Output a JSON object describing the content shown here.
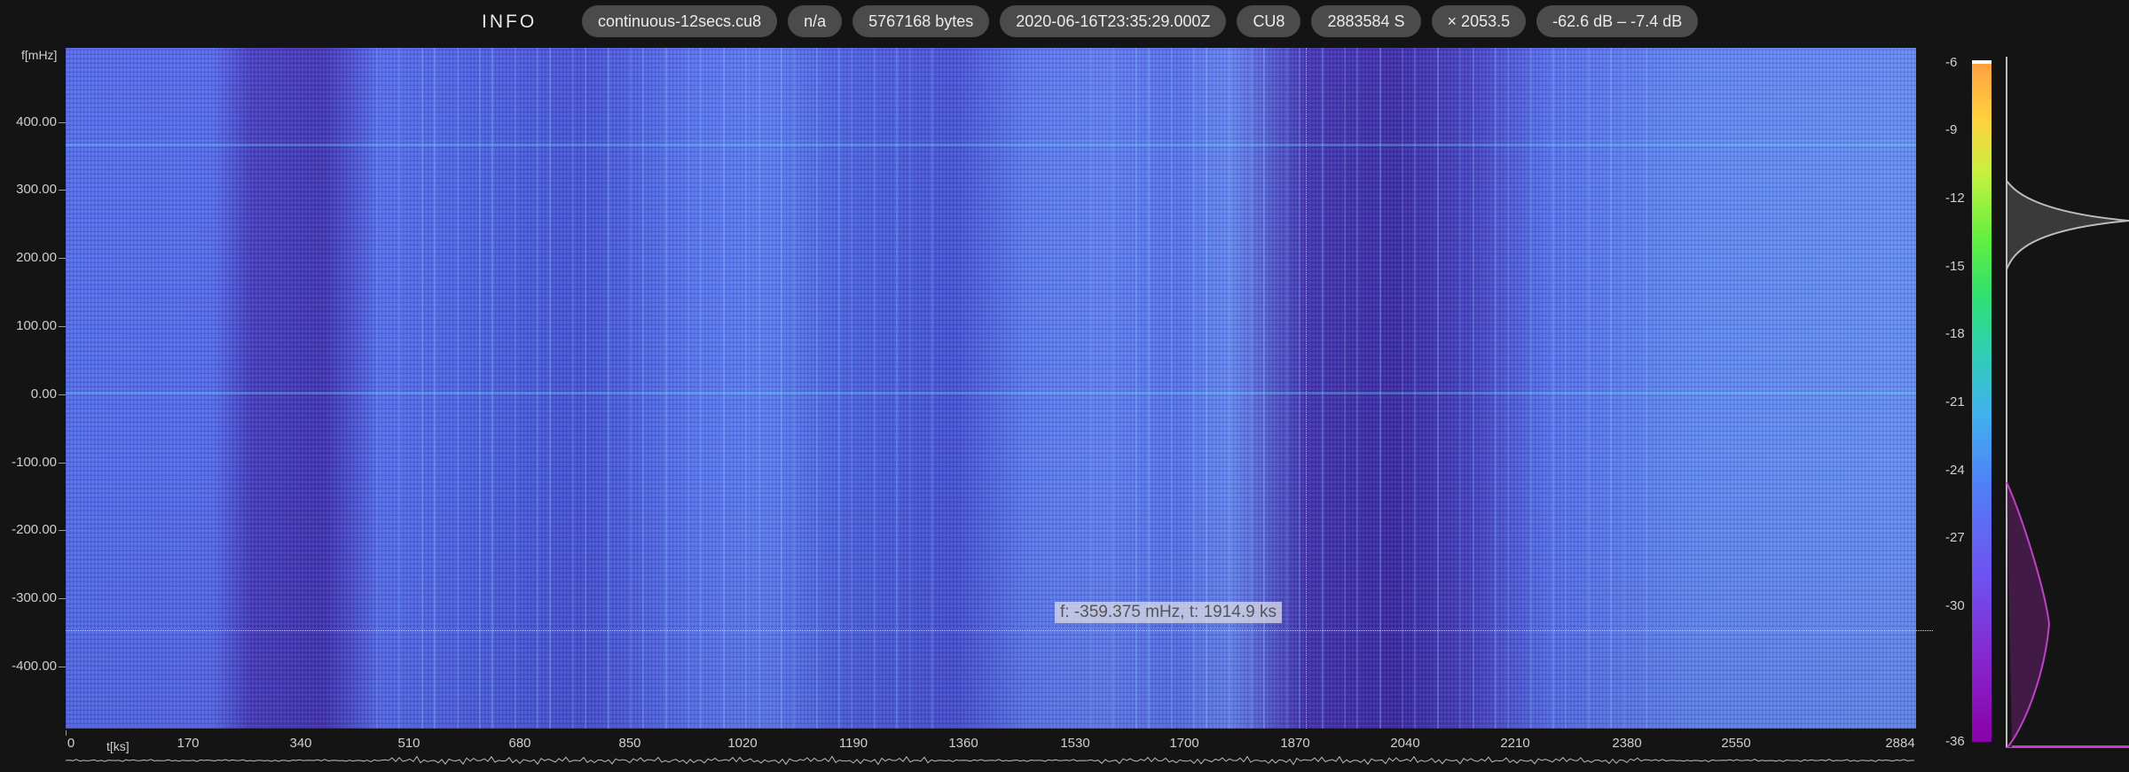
{
  "header": {
    "title": "INFO",
    "pills": [
      "continuous-12secs.cu8",
      "n/a",
      "5767168 bytes",
      "2020-06-16T23:35:29.000Z",
      "CU8",
      "2883584 S",
      "× 2053.5",
      "-62.6 dB – -7.4 dB"
    ]
  },
  "y_axis": {
    "unit": "f[mHz]",
    "ticks": [
      "400.00",
      "300.00",
      "200.00",
      "100.00",
      "0.00",
      "-100.00",
      "-200.00",
      "-300.00",
      "-400.00"
    ]
  },
  "x_axis": {
    "unit": "t[ks]",
    "ticks": [
      "0",
      "170",
      "340",
      "510",
      "680",
      "850",
      "1020",
      "1190",
      "1360",
      "1530",
      "1700",
      "1870",
      "2040",
      "2210",
      "2380",
      "2550",
      "2884"
    ]
  },
  "cursor": {
    "label": "f: -359.375 mHz, t: 1914.9 ks"
  },
  "color_scale": {
    "ticks": [
      "-6",
      "-9",
      "-12",
      "-15",
      "-18",
      "-21",
      "-24",
      "-27",
      "-30",
      "-36"
    ],
    "histogram_color": "#c040c8"
  },
  "colors": {
    "background": "#141414",
    "pill": "#4b4b4b"
  }
}
